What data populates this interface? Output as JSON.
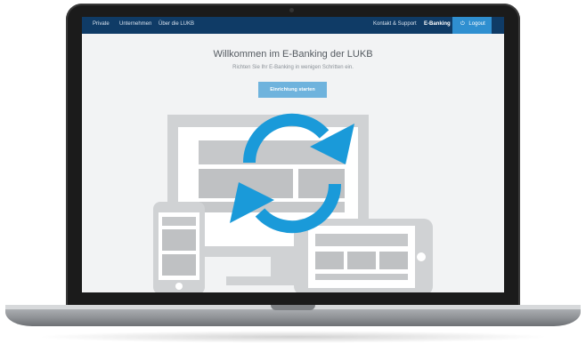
{
  "nav": {
    "left_items": [
      "Private",
      "Unternehmen",
      "Über die LUKB"
    ],
    "right_items": [
      "Kontakt & Support",
      "E-Banking"
    ],
    "active_item": "E-Banking",
    "logout_label": "Logout"
  },
  "main": {
    "title": "Willkommen im E-Banking der LUKB",
    "subtitle": "Richten Sie Ihr E-Banking in wenigen Schritten ein.",
    "cta_label": "Einrichtung starten"
  },
  "icons": {
    "refresh": "refresh-icon",
    "power": "power-icon"
  },
  "colors": {
    "nav_bg": "#0f3b66",
    "logout_bg": "#2f8fd0",
    "cta_bg": "#6fb3dd",
    "refresh_blue": "#1a9ad9",
    "device_grey": "#d0d2d4"
  }
}
